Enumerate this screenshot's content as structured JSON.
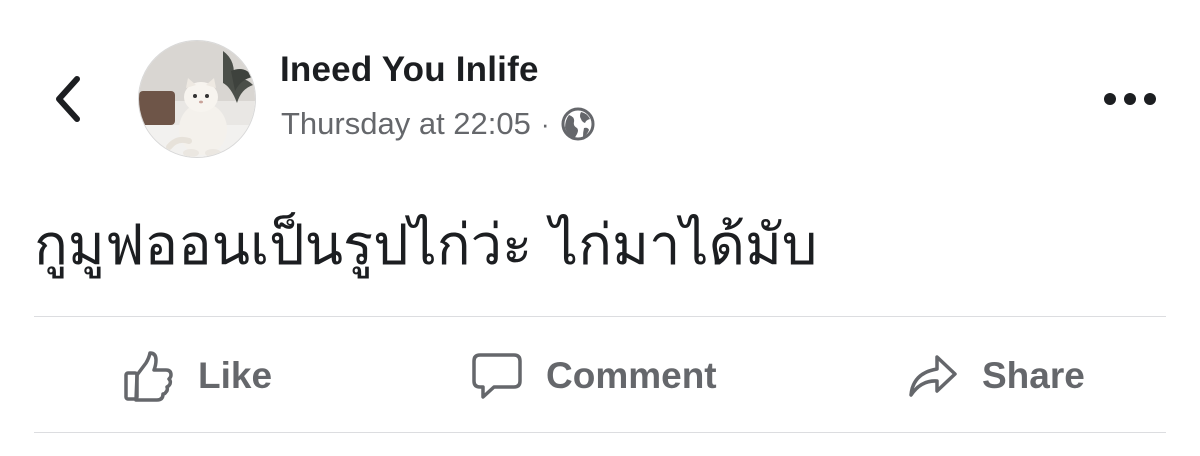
{
  "post": {
    "author_name": "Ineed You Inlife",
    "timestamp": "Thursday at 22:05",
    "separator": "·",
    "privacy_icon": "globe-icon",
    "text": "กูมูฟออนเป็นรูปไก่ว่ะ ไก่มาได้มับ"
  },
  "header": {
    "back_icon": "chevron-left-icon",
    "more_icon": "more-horizontal-icon"
  },
  "actions": {
    "like_label": "Like",
    "comment_label": "Comment",
    "share_label": "Share"
  },
  "colors": {
    "text_primary": "#1c1e21",
    "text_secondary": "#65676b",
    "divider": "#dcdde0"
  }
}
